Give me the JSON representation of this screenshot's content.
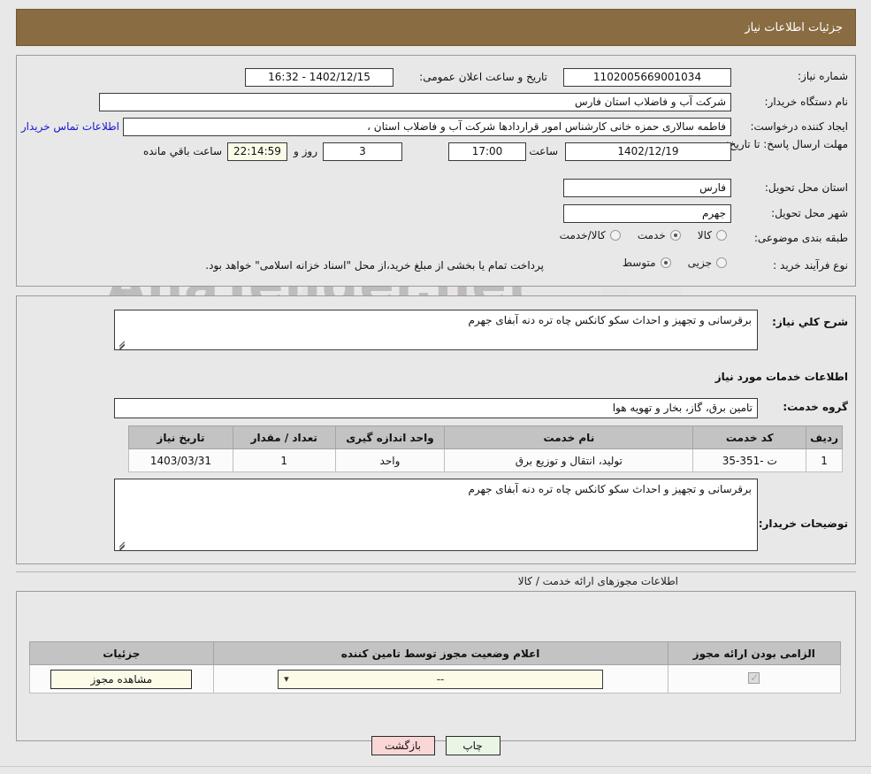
{
  "header": {
    "title": "جزئیات اطلاعات نیاز"
  },
  "top_form": {
    "need_number_label": "شماره نیاز:",
    "need_number_value": "1102005669001034",
    "announce_datetime_label": "تاریخ و ساعت اعلان عمومی:",
    "announce_datetime_value": "1402/12/15 - 16:32",
    "buyer_org_label": "نام دستگاه خریدار:",
    "buyer_org_value": "شرکت آب و فاضلاب استان فارس",
    "requester_label": "ایجاد کننده درخواست:",
    "requester_value": "فاطمه سالاری حمزه خانی کارشناس امور قراردادها شرکت آب و فاضلاب استان ،",
    "buyer_contact_link": "اطلاعات تماس خریدار",
    "deadline_label": "مهلت ارسال پاسخ: تا تاریخ:",
    "deadline_date": "1402/12/19",
    "deadline_hour_label": "ساعت",
    "deadline_hour": "17:00",
    "remaining_days": "3",
    "days_and_label": "روز و",
    "remaining_time": "22:14:59",
    "remaining_hours_label": "ساعت باقي مانده",
    "delivery_province_label": "استان محل تحویل:",
    "delivery_province_value": "فارس",
    "delivery_city_label": "شهر محل تحویل:",
    "delivery_city_value": "جهرم",
    "category_label": "طبقه بندی موضوعی:",
    "category_options": [
      {
        "label": "کالا",
        "selected": false
      },
      {
        "label": "خدمت",
        "selected": true
      },
      {
        "label": "کالا/خدمت",
        "selected": false
      }
    ],
    "process_label": "نوع فرآیند خرید :",
    "process_options": [
      {
        "label": "جزیی",
        "selected": false
      },
      {
        "label": "متوسط",
        "selected": true
      }
    ],
    "process_note": "پرداخت تمام یا بخشی از مبلغ خرید،از محل \"اسناد خزانه اسلامی\" خواهد بود."
  },
  "middle": {
    "general_desc_label": "شرح کلي نیاز:",
    "general_desc_value": "برقرسانی و تجهیز و احداث سکو کانکس چاه تره دنه آبفای جهرم",
    "services_info_title": "اطلاعات خدمات مورد نیاز",
    "service_group_label": "گروه خدمت:",
    "service_group_value": "تامین برق، گاز، بخار و تهویه هوا",
    "table": {
      "headers": [
        "ردیف",
        "کد خدمت",
        "نام خدمت",
        "واحد اندازه گیری",
        "تعداد / مقدار",
        "تاریخ نیاز"
      ],
      "rows": [
        {
          "row": "1",
          "code": "ت -351-35",
          "name": "تولید، انتقال و توزیع برق",
          "unit": "واحد",
          "qty": "1",
          "date": "1403/03/31"
        }
      ]
    },
    "buyer_notes_label": "توضیحات خریدار:",
    "buyer_notes_value": "برقرسانی و تجهیز و احداث سکو کانکس چاه تره دنه آبفای جهرم"
  },
  "permissions": {
    "caption": "اطلاعات مجوزهای ارائه خدمت / کالا",
    "headers": [
      "الزامی بودن ارائه مجوز",
      "اعلام وضعیت مجوز توسط تامین کننده",
      "جزئیات"
    ],
    "rows": [
      {
        "required_checked": true,
        "status_value": "--",
        "details_button": "مشاهده مجوز"
      }
    ]
  },
  "footer": {
    "print_label": "چاپ",
    "back_label": "بازگشت"
  },
  "watermark": {
    "text": "AnaTender.net"
  },
  "colors": {
    "header_bar": "#8a6c43",
    "page_bg": "#e8e8e8",
    "link": "#1515d0",
    "table_header": "#c3c3c3",
    "print_btn": "#e9f5e5",
    "back_btn": "#fbd6d6",
    "field_yellow": "#fbfbe8"
  }
}
